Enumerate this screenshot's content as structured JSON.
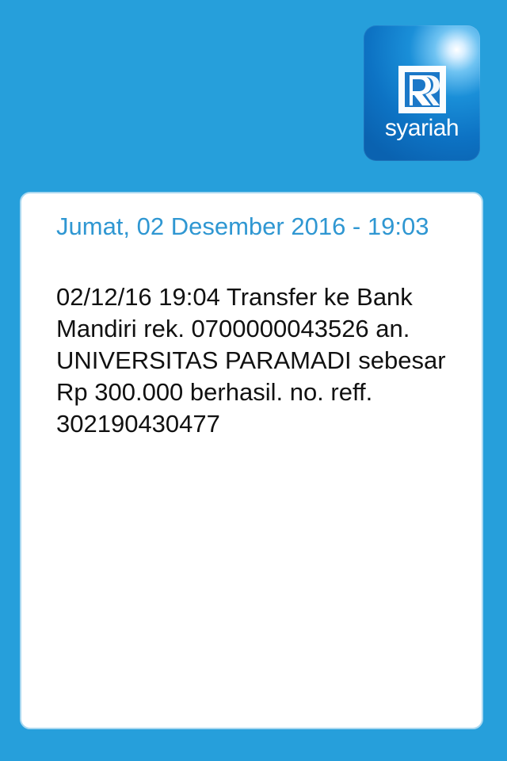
{
  "brand": {
    "logo_text": "syariah",
    "accent_color": "#269fdb"
  },
  "message_card": {
    "date_time": "Jumat, 02 Desember 2016 - 19:03",
    "body": "02/12/16 19:04 Transfer ke Bank Mandiri rek. 0700000043526 an. UNIVERSITAS PARAMADI sebesar Rp 300.000 berhasil. no. reff. 302190430477"
  }
}
